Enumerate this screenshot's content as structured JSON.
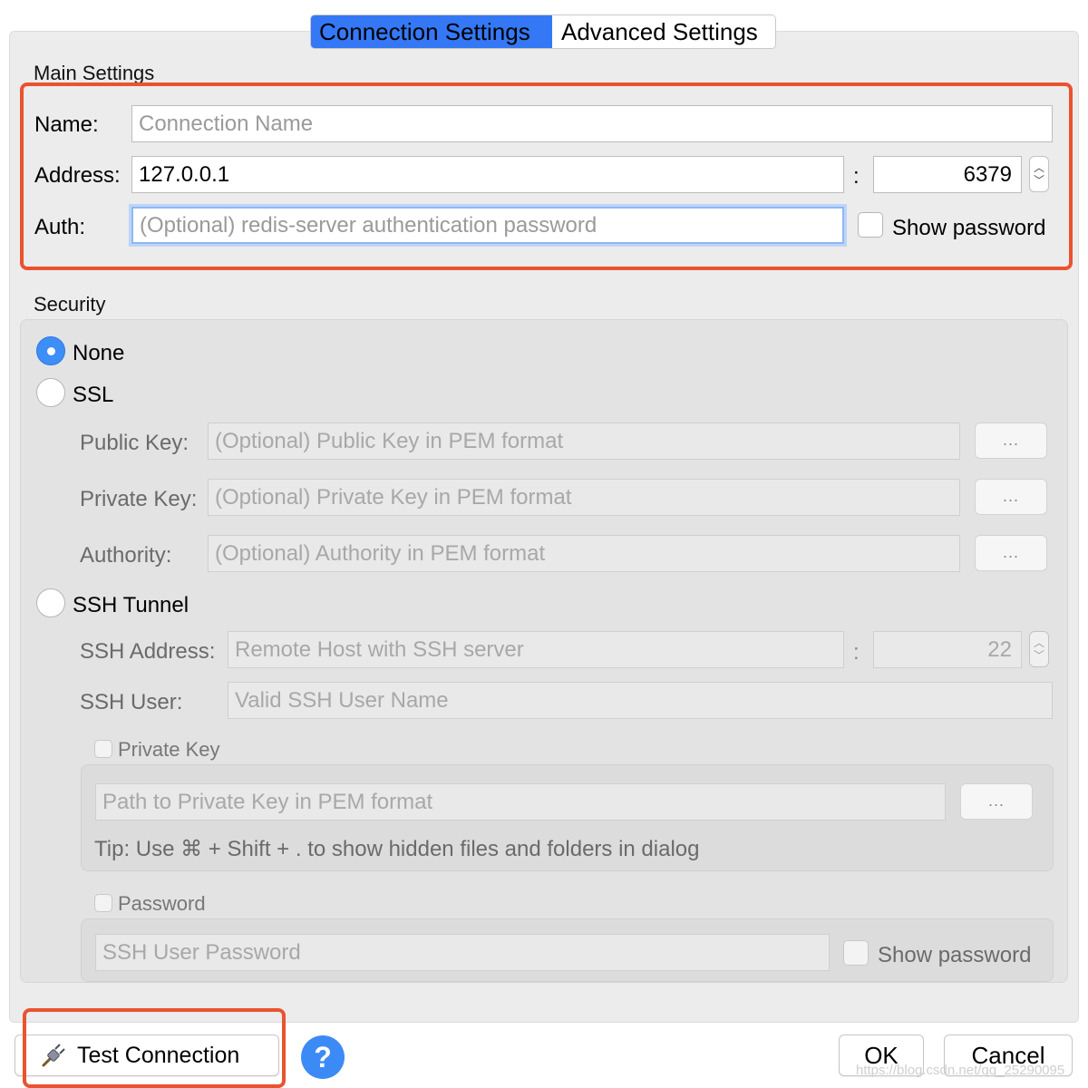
{
  "tabs": {
    "connection_settings": "Connection Settings",
    "advanced_settings": "Advanced Settings"
  },
  "main_settings": {
    "title": "Main Settings",
    "name_label": "Name:",
    "name_placeholder": "Connection Name",
    "address_label": "Address:",
    "address_value": "127.0.0.1",
    "colon": ":",
    "port_value": "6379",
    "auth_label": "Auth:",
    "auth_placeholder": "(Optional) redis-server authentication password",
    "show_password_label": "Show password"
  },
  "security": {
    "title": "Security",
    "none_label": "None",
    "ssl_label": "SSL",
    "public_key_label": "Public Key:",
    "public_key_placeholder": "(Optional) Public Key in PEM format",
    "private_key_label": "Private Key:",
    "private_key_placeholder": "(Optional) Private Key in PEM format",
    "authority_label": "Authority:",
    "authority_placeholder": "(Optional) Authority in PEM format",
    "browse_label": "...",
    "ssh_tunnel_label": "SSH Tunnel",
    "ssh_address_label": "SSH Address:",
    "ssh_address_placeholder": "Remote Host with SSH server",
    "ssh_port_value": "22",
    "ssh_user_label": "SSH User:",
    "ssh_user_placeholder": "Valid SSH User Name",
    "private_key_check_label": "Private Key",
    "key_path_placeholder": "Path to Private Key in PEM format",
    "tip_text": "Tip: Use ⌘ + Shift + . to show hidden files and folders in dialog",
    "password_check_label": "Password",
    "ssh_password_placeholder": "SSH User Password",
    "ssh_show_password_label": "Show password"
  },
  "footer": {
    "test_connection_label": "Test Connection",
    "help_label": "?",
    "ok_label": "OK",
    "cancel_label": "Cancel",
    "watermark": "https://blog.csdn.net/qq_25290095"
  },
  "colors": {
    "accent": "#3478f6",
    "highlight": "#e9532f"
  },
  "icons": {
    "test_connection": "plug-icon",
    "help": "question-icon"
  }
}
